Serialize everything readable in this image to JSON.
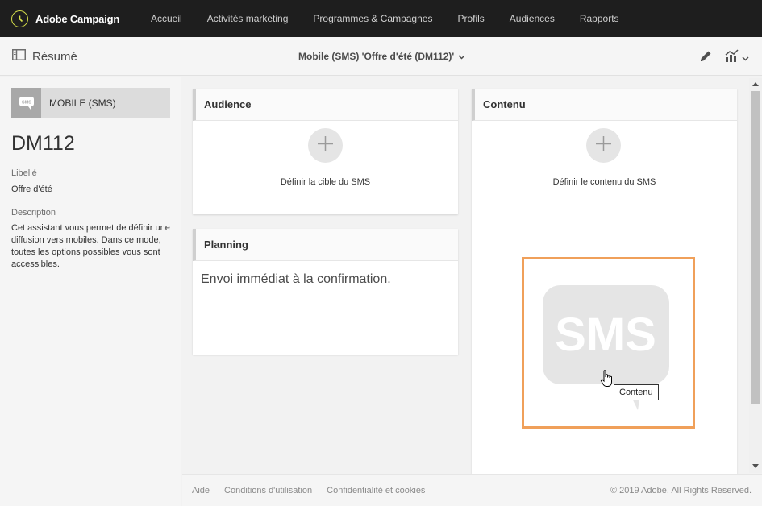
{
  "app": {
    "name": "Adobe Campaign",
    "logo_icon": "adobe-campaign-logo-icon",
    "accent": "#d7e04b"
  },
  "nav": {
    "items": [
      {
        "label": "Accueil"
      },
      {
        "label": "Activités marketing"
      },
      {
        "label": "Programmes & Campagnes"
      },
      {
        "label": "Profils"
      },
      {
        "label": "Audiences"
      },
      {
        "label": "Rapports"
      }
    ]
  },
  "subheader": {
    "summary_label": "Résumé",
    "title": "Mobile (SMS) 'Offre d'été (DM112)'",
    "edit_icon": "pencil-icon",
    "chart_icon": "chart-icon"
  },
  "sidebar": {
    "channel_label": "MOBILE (SMS)",
    "channel_icon_text": "SMS",
    "code": "DM112",
    "label_title": "Libellé",
    "label_value": "Offre d'été",
    "description_title": "Description",
    "description_value": "Cet assistant vous permet de définir une diffusion vers mobiles. Dans ce mode, toutes les options possibles vous sont accessibles."
  },
  "cards": {
    "audience": {
      "title": "Audience",
      "action": "Définir la cible du SMS"
    },
    "planning": {
      "title": "Planning",
      "text": "Envoi immédiat à la confirmation."
    },
    "content": {
      "title": "Contenu",
      "action": "Définir le contenu du SMS",
      "sms_text": "SMS",
      "tooltip": "Contenu",
      "highlight_color": "#f0a05a"
    }
  },
  "footer": {
    "links": [
      {
        "label": "Aide"
      },
      {
        "label": "Conditions d'utilisation"
      },
      {
        "label": "Confidentialité et cookies"
      }
    ],
    "copyright": "© 2019 Adobe. All Rights Reserved."
  }
}
